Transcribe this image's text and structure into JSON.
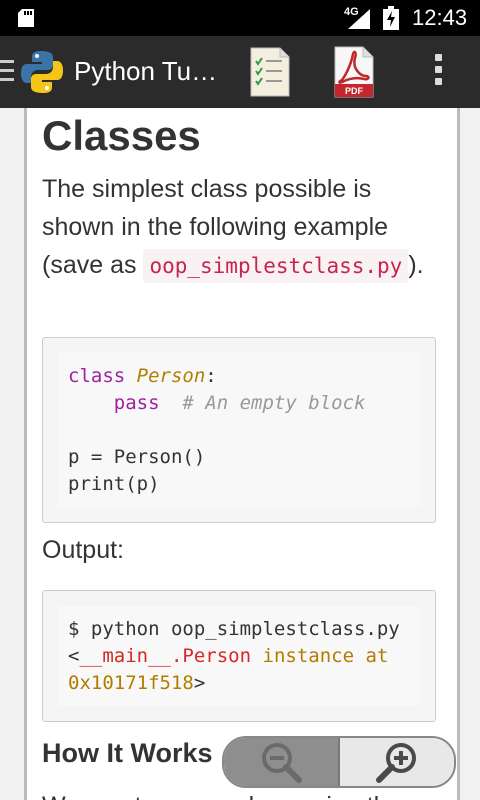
{
  "status": {
    "network": "4G",
    "time": "12:43"
  },
  "appbar": {
    "title": "Python Tu…"
  },
  "article": {
    "heading": "Classes",
    "intro": "The simplest class possible is shown in the following example (save as",
    "filename": "oop_simplestclass.py",
    "intro_end": ").",
    "code": {
      "kw_class": "class",
      "class_name": "Person",
      "colon": ":",
      "kw_pass": "pass",
      "comment": "# An empty block",
      "line3": "p = Person()",
      "line4": "print(p)"
    },
    "output_label": "Output:",
    "output": {
      "line1": "$ python oop_simplestclass.py",
      "lt": "<",
      "main": "__main__",
      "dot_person": ".Person",
      "instance_at": "instance at",
      "addr": "0x10171f518",
      "gt": ">"
    },
    "subheading": "How It Works",
    "cut_line": "We create a new class using the"
  },
  "zoom": {
    "out_icon": "zoom-out-icon",
    "in_icon": "zoom-in-icon"
  }
}
